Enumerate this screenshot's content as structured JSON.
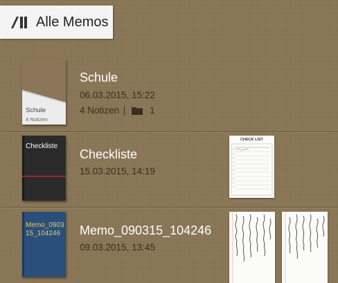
{
  "header": {
    "title": "Alle Memos",
    "icon": "notebooks-icon"
  },
  "memos": [
    {
      "name": "Schule",
      "date": "06.03.2015, 15:22",
      "notes_count": "4 Notizen",
      "folder_count": "1",
      "cover": {
        "title": "Schule",
        "subtitle": "4 Notizen",
        "color": "#8c7659"
      }
    },
    {
      "name": "Checkliste",
      "date": "15.03.2015, 14:19",
      "cover": {
        "title": "Checkliste",
        "color": "#2b2b2b",
        "accent": "#b0332b"
      },
      "thumb_title": "CHECK LIST"
    },
    {
      "name": "Memo_090315_104246",
      "date": "09.03.2015, 13:45",
      "cover": {
        "title_line1": "Memo_0903",
        "title_line2": "15_104246",
        "color": "#2a4f7a",
        "text_color": "#e5c95a"
      }
    }
  ]
}
